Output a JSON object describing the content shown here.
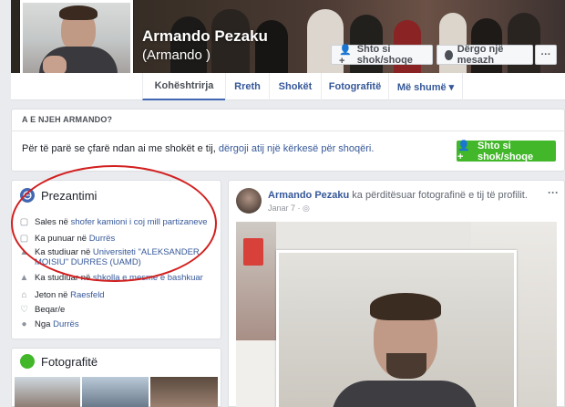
{
  "profile": {
    "name": "Armando Pezaku",
    "alt_name": "(Armando )"
  },
  "header_buttons": {
    "add_friend": "Shto si shok/shoqe",
    "message": "Dërgo një mesazh",
    "more": "···"
  },
  "tabs": [
    {
      "label": "Kohështrirja"
    },
    {
      "label": "Rreth"
    },
    {
      "label": "Shokët"
    },
    {
      "label": "Fotografitë"
    },
    {
      "label": "Më shumë ▾"
    }
  ],
  "know_box": {
    "heading": "A E NJEH ARMANDO?",
    "text_before": "Për të parë se çfarë ndan ai me shokët e tij, ",
    "link_text": "dërgoji atij një kërkesë për shoqëri.",
    "button": "Shto si shok/shoqe"
  },
  "intro": {
    "title": "Prezantimi",
    "items": [
      {
        "icon": "briefcase-icon",
        "prefix": "Sales në ",
        "link": "shofer kamioni i coj mill partizaneve"
      },
      {
        "icon": "briefcase-icon",
        "prefix": "Ka punuar në ",
        "link": "Durrës"
      },
      {
        "icon": "graduation-cap-icon",
        "prefix": "Ka studiuar në ",
        "link": "Universiteti \"ALEKSANDER MOISIU\" DURRES (UAMD)"
      },
      {
        "icon": "graduation-cap-icon",
        "prefix": "Ka studiuar në ",
        "link": "shkolla e mesme e bashkuar"
      },
      {
        "icon": "home-icon",
        "prefix": "Jeton në ",
        "link": "Raesfeld"
      },
      {
        "icon": "heart-icon",
        "prefix": "Beqar/e",
        "link": ""
      },
      {
        "icon": "location-pin-icon",
        "prefix": "Nga ",
        "link": "Durrës"
      }
    ]
  },
  "photos": {
    "title": "Fotografitë"
  },
  "post": {
    "author": "Armando Pezaku",
    "action": " ka përditësuar fotografinë e tij të profilit.",
    "date": "Janar 7 · ",
    "menu": "···"
  },
  "colors": {
    "link": "#365899",
    "green": "#42b72a",
    "annotation_red": "#d21f1f"
  }
}
